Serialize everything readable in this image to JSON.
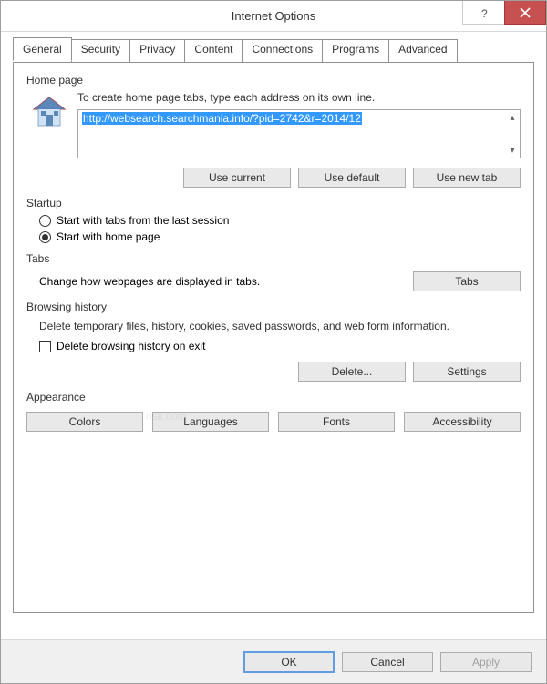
{
  "window": {
    "title": "Internet Options"
  },
  "tabs": [
    "General",
    "Security",
    "Privacy",
    "Content",
    "Connections",
    "Programs",
    "Advanced"
  ],
  "homepage": {
    "label": "Home page",
    "desc": "To create home page tabs, type each address on its own line.",
    "url": "http://websearch.searchmania.info/?pid=2742&r=2014/12",
    "use_current": "Use current",
    "use_default": "Use default",
    "use_new_tab": "Use new tab"
  },
  "startup": {
    "label": "Startup",
    "opt_last": "Start with tabs from the last session",
    "opt_home": "Start with home page"
  },
  "tabsect": {
    "label": "Tabs",
    "desc": "Change how webpages are displayed in tabs.",
    "button": "Tabs"
  },
  "history": {
    "label": "Browsing history",
    "desc": "Delete temporary files, history, cookies, saved passwords, and web form information.",
    "delete_on_exit": "Delete browsing history on exit",
    "delete_btn": "Delete...",
    "settings_btn": "Settings"
  },
  "appearance": {
    "label": "Appearance",
    "colors": "Colors",
    "languages": "Languages",
    "fonts": "Fonts",
    "accessibility": "Accessibility"
  },
  "footer": {
    "ok": "OK",
    "cancel": "Cancel",
    "apply": "Apply"
  }
}
